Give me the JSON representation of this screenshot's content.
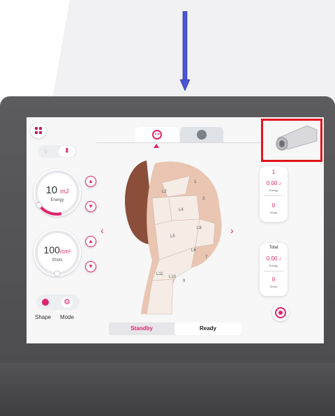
{
  "colors": {
    "accent": "#e0246e",
    "highlight": "#e3141c",
    "arrow": "#4a55d6",
    "bezel": "#4f4f51"
  },
  "icons": {
    "menu": "grid-icon",
    "face_tab": "face-icon",
    "body_tab": "head-profile-icon",
    "handpiece": "handpiece-icon",
    "mode_a": "dots-icon",
    "mode_b": "stamp-icon",
    "shape": "circle-dot-icon",
    "mode": "gear-icon",
    "nav_prev": "chevron-left-icon",
    "nav_next": "chevron-right-icon",
    "reset": "refresh-icon"
  },
  "energy": {
    "value": "10",
    "unit": "mJ",
    "label": "Energy"
  },
  "shots": {
    "value": "100",
    "unit": "/cm²",
    "label": "Shots"
  },
  "controls": {
    "shape": "Shape",
    "mode": "Mode"
  },
  "status": {
    "standby": "Standby",
    "ready": "Ready"
  },
  "right_panel": {
    "index": "1",
    "energy_value": "0.00",
    "energy_unit": "J",
    "energy_label": "Energy",
    "shots_value": "0",
    "shots_label": "Shots"
  },
  "total_panel": {
    "title": "Total",
    "energy_value": "0.00",
    "energy_unit": "J",
    "energy_label": "Energy",
    "shots_value": "0",
    "shots_label": "Shots"
  },
  "zones": {
    "l1": "1",
    "l2": "L2",
    "l3": "3",
    "l4": "L4",
    "l5": "L5",
    "l6": "L6",
    "l7": "7",
    "l8": "L8",
    "l9": "9",
    "l10": "L10",
    "l11": "L11"
  }
}
